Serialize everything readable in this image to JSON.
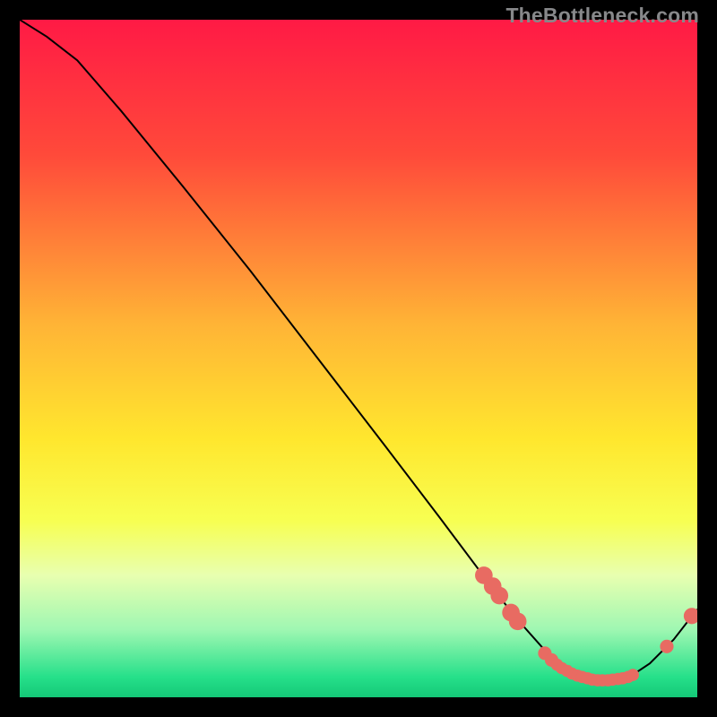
{
  "watermark": "TheBottleneck.com",
  "chart_data": {
    "type": "line",
    "title": "",
    "xlabel": "",
    "ylabel": "",
    "xlim": [
      0,
      100
    ],
    "ylim": [
      0,
      100
    ],
    "gradient_stops": [
      {
        "offset": 0,
        "color": "#ff1a45"
      },
      {
        "offset": 0.2,
        "color": "#ff4a3a"
      },
      {
        "offset": 0.45,
        "color": "#ffb436"
      },
      {
        "offset": 0.62,
        "color": "#ffe72e"
      },
      {
        "offset": 0.74,
        "color": "#f7ff52"
      },
      {
        "offset": 0.82,
        "color": "#e8ffb0"
      },
      {
        "offset": 0.9,
        "color": "#9ff7b2"
      },
      {
        "offset": 0.97,
        "color": "#26e08a"
      },
      {
        "offset": 1.0,
        "color": "#14c877"
      }
    ],
    "series": [
      {
        "name": "curve",
        "points": [
          {
            "x": 0.0,
            "y": 100.0
          },
          {
            "x": 4.0,
            "y": 97.5
          },
          {
            "x": 8.5,
            "y": 94.0
          },
          {
            "x": 15.0,
            "y": 86.5
          },
          {
            "x": 24.0,
            "y": 75.5
          },
          {
            "x": 34.0,
            "y": 63.0
          },
          {
            "x": 44.0,
            "y": 50.0
          },
          {
            "x": 54.0,
            "y": 37.0
          },
          {
            "x": 62.0,
            "y": 26.5
          },
          {
            "x": 68.0,
            "y": 18.5
          },
          {
            "x": 73.0,
            "y": 12.0
          },
          {
            "x": 77.0,
            "y": 7.5
          },
          {
            "x": 80.0,
            "y": 4.5
          },
          {
            "x": 83.5,
            "y": 2.8
          },
          {
            "x": 87.0,
            "y": 2.4
          },
          {
            "x": 90.0,
            "y": 3.0
          },
          {
            "x": 93.0,
            "y": 5.0
          },
          {
            "x": 96.5,
            "y": 8.5
          },
          {
            "x": 100.0,
            "y": 13.0
          }
        ]
      }
    ],
    "markers": [
      {
        "x": 68.5,
        "y": 18.0,
        "r": 1.3
      },
      {
        "x": 69.8,
        "y": 16.4,
        "r": 1.3
      },
      {
        "x": 70.8,
        "y": 15.0,
        "r": 1.3
      },
      {
        "x": 72.5,
        "y": 12.5,
        "r": 1.3
      },
      {
        "x": 73.5,
        "y": 11.2,
        "r": 1.3
      },
      {
        "x": 77.5,
        "y": 6.5,
        "r": 1.0
      },
      {
        "x": 78.5,
        "y": 5.5,
        "r": 1.0
      },
      {
        "x": 79.3,
        "y": 4.8,
        "r": 0.9
      },
      {
        "x": 80.0,
        "y": 4.3,
        "r": 0.9
      },
      {
        "x": 80.8,
        "y": 3.9,
        "r": 0.9
      },
      {
        "x": 81.5,
        "y": 3.5,
        "r": 0.9
      },
      {
        "x": 82.3,
        "y": 3.2,
        "r": 0.9
      },
      {
        "x": 83.0,
        "y": 3.0,
        "r": 0.9
      },
      {
        "x": 83.8,
        "y": 2.8,
        "r": 0.9
      },
      {
        "x": 84.5,
        "y": 2.6,
        "r": 0.9
      },
      {
        "x": 85.3,
        "y": 2.5,
        "r": 0.9
      },
      {
        "x": 86.0,
        "y": 2.5,
        "r": 0.9
      },
      {
        "x": 86.8,
        "y": 2.5,
        "r": 0.9
      },
      {
        "x": 87.5,
        "y": 2.6,
        "r": 0.9
      },
      {
        "x": 88.3,
        "y": 2.7,
        "r": 0.9
      },
      {
        "x": 89.0,
        "y": 2.8,
        "r": 0.9
      },
      {
        "x": 89.8,
        "y": 3.0,
        "r": 0.9
      },
      {
        "x": 90.5,
        "y": 3.3,
        "r": 0.9
      },
      {
        "x": 95.5,
        "y": 7.5,
        "r": 1.0
      },
      {
        "x": 99.2,
        "y": 12.0,
        "r": 1.2
      }
    ],
    "marker_color": "#e86b62",
    "curve_color": "#000000"
  }
}
